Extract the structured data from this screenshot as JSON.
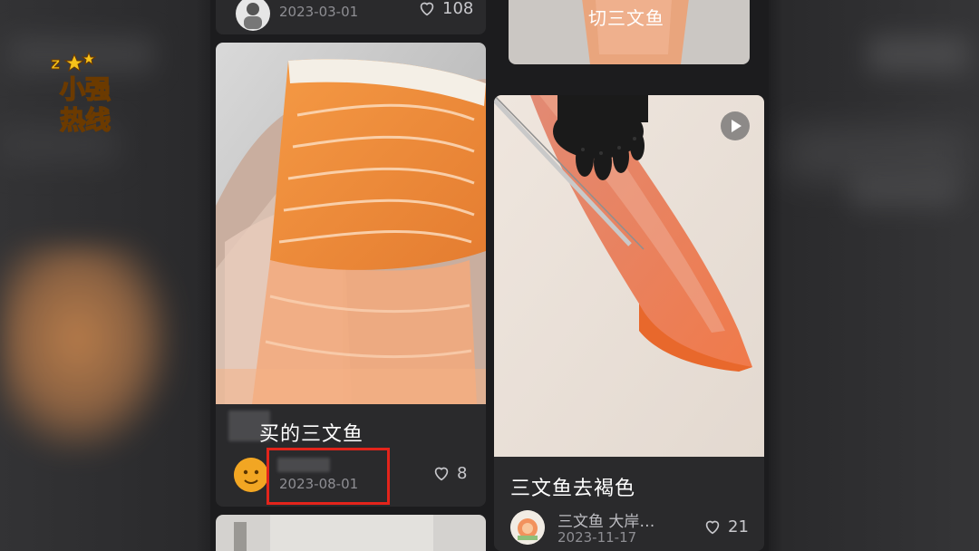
{
  "watermark": {
    "text": "小强热线",
    "line1": "小强",
    "line2": "热线"
  },
  "feed": {
    "top_left_card": {
      "date": "2023-03-01",
      "likes": "108"
    },
    "top_right_card": {
      "title": "切三文鱼"
    },
    "card_left": {
      "title": "买的三文鱼",
      "date": "2023-08-01",
      "likes": "8"
    },
    "card_right": {
      "title": "三文鱼去褐色",
      "username": "三文鱼 大岸…",
      "date": "2023-11-17",
      "likes": "21",
      "badge_icon": "play-icon"
    }
  },
  "colors": {
    "highlight": "#e3241b",
    "card_bg": "#2a2a2c",
    "feed_bg": "#1c1c1e",
    "salmon": "#f08a3c"
  }
}
